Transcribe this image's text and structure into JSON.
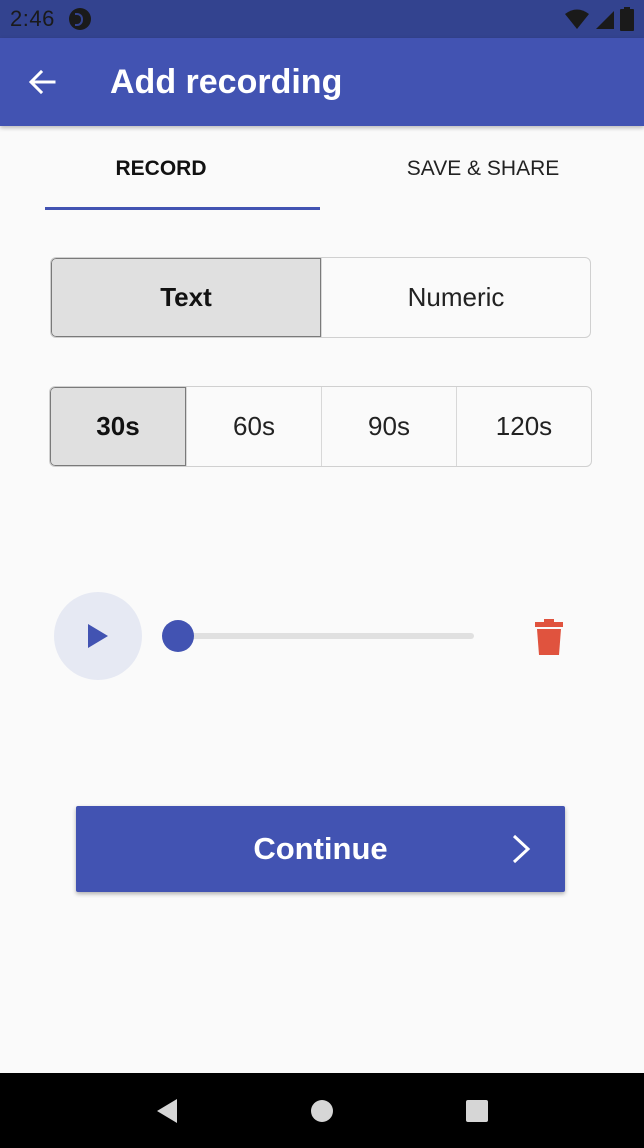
{
  "status_bar": {
    "time": "2:46"
  },
  "app_bar": {
    "title": "Add recording",
    "back_icon": "arrow-left-icon"
  },
  "tabs": [
    {
      "label": "RECORD",
      "active": true
    },
    {
      "label": "SAVE & SHARE",
      "active": false
    }
  ],
  "mode_options": [
    {
      "label": "Text",
      "selected": true
    },
    {
      "label": "Numeric",
      "selected": false
    }
  ],
  "duration_options": [
    {
      "label": "30s",
      "selected": true
    },
    {
      "label": "60s",
      "selected": false
    },
    {
      "label": "90s",
      "selected": false
    },
    {
      "label": "120s",
      "selected": false
    }
  ],
  "player": {
    "play_icon": "play-icon",
    "progress": 0,
    "delete_icon": "trash-icon"
  },
  "continue_button": {
    "label": "Continue",
    "icon": "chevron-right-icon"
  },
  "colors": {
    "primary": "#4253b2",
    "status_bar": "#33438f",
    "delete": "#e0533e"
  }
}
